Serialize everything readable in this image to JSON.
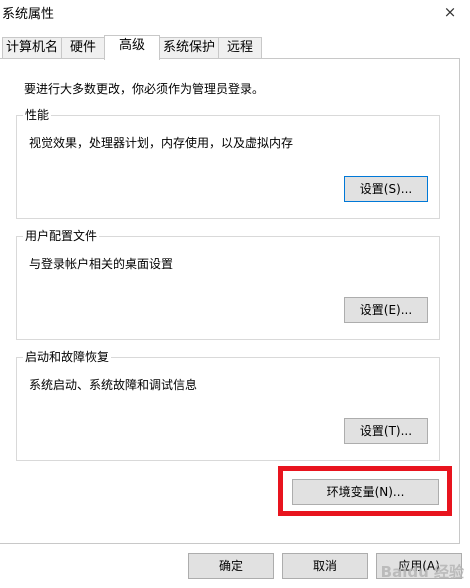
{
  "window": {
    "title": "系统属性",
    "close_glyph": "×"
  },
  "tabs": [
    {
      "label": "计算机名"
    },
    {
      "label": "硬件"
    },
    {
      "label": "高级",
      "active": true
    },
    {
      "label": "系统保护"
    },
    {
      "label": "远程"
    }
  ],
  "notice": "要进行大多数更改，你必须作为管理员登录。",
  "groups": {
    "performance": {
      "title": "性能",
      "description": "视觉效果，处理器计划，内存使用，以及虚拟内存",
      "button": "设置(S)..."
    },
    "user_profiles": {
      "title": "用户配置文件",
      "description": "与登录帐户相关的桌面设置",
      "button": "设置(E)..."
    },
    "startup_recovery": {
      "title": "启动和故障恢复",
      "description": "系统启动、系统故障和调试信息",
      "button": "设置(T)..."
    }
  },
  "env_button": "环境变量(N)...",
  "footer": {
    "ok": "确定",
    "cancel": "取消",
    "apply": "应用(A)"
  },
  "watermark": "Baidu 经验",
  "colors": {
    "highlight": "#e8141e",
    "button_face": "#e1e1e1",
    "focus_border": "#0078d7"
  }
}
